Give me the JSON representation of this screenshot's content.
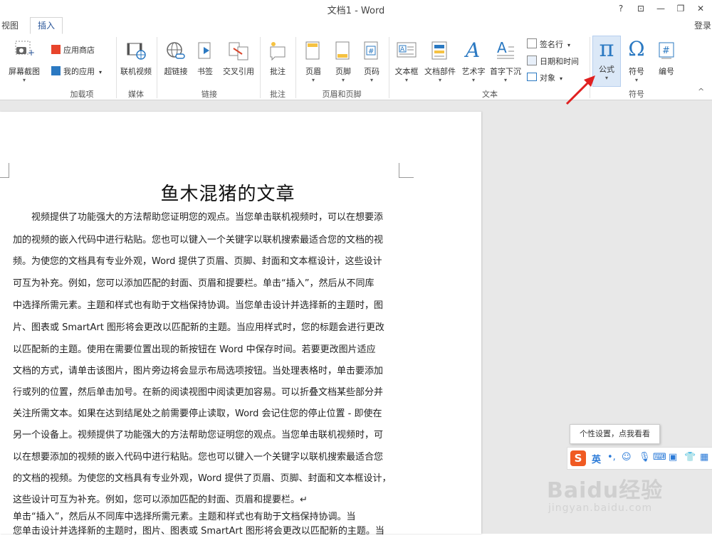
{
  "window": {
    "title": "文档1 - Word",
    "help": "?",
    "controls": [
      "⊡",
      "—",
      "❐",
      "✕"
    ],
    "login": "登录"
  },
  "tabs": {
    "view": "视图",
    "insert": "插入"
  },
  "ribbon": {
    "groups": {
      "addins": "加载项",
      "media": "媒体",
      "links": "链接",
      "comments": "批注",
      "header_footer": "页眉和页脚",
      "text": "文本",
      "symbols": "符号"
    },
    "buttons": {
      "screenshot": "屏幕截图",
      "app_store": "应用商店",
      "my_apps": "我的应用",
      "online_video": "联机视频",
      "hyperlink": "超链接",
      "bookmark": "书签",
      "cross_reference": "交叉引用",
      "comment": "批注",
      "header": "页眉",
      "footer": "页脚",
      "page_number": "页码",
      "text_box": "文本框",
      "quick_parts": "文档部件",
      "wordart": "艺术字",
      "drop_cap": "首字下沉",
      "signature_line": "签名行",
      "date_time": "日期和时间",
      "object": "对象",
      "equation": "公式",
      "symbol": "符号",
      "number": "编号"
    },
    "collapse": "^"
  },
  "document": {
    "heading": "鱼木混猪的文章",
    "lines": [
      "视频提供了功能强大的方法帮助您证明您的观点。当您单击联机视频时，可以在想要添",
      "加的视频的嵌入代码中进行粘贴。您也可以键入一个关键字以联机搜索最适合您的文档的视",
      "频。为使您的文档具有专业外观，Word 提供了页眉、页脚、封面和文本框设计，这些设计",
      "可互为补充。例如，您可以添加匹配的封面、页眉和提要栏。单击“插入”，然后从不同库",
      "中选择所需元素。主题和样式也有助于文档保持协调。当您单击设计并选择新的主题时，图",
      "片、图表或 SmartArt 图形将会更改以匹配新的主题。当应用样式时，您的标题会进行更改",
      "以匹配新的主题。使用在需要位置出现的新按钮在 Word 中保存时间。若要更改图片适应",
      "文档的方式，请单击该图片，图片旁边将会显示布局选项按钮。当处理表格时，单击要添加",
      "行或列的位置，然后单击加号。在新的阅读视图中阅读更加容易。可以折叠文档某些部分并",
      "关注所需文本。如果在达到结尾处之前需要停止读取，Word 会记住您的停止位置 - 即使在",
      "另一个设备上。视频提供了功能强大的方法帮助您证明您的观点。当您单击联机视频时，可",
      "以在想要添加的视频的嵌入代码中进行粘贴。您也可以键入一个关键字以联机搜索最适合您",
      "的文档的视频。为使您的文档具有专业外观，Word 提供了页眉、页脚、封面和文本框设计，",
      "这些设计可互为补充。例如，您可以添加匹配的封面、页眉和提要栏。↵",
      "    单击“插入”，然后从不同库中选择所需元素。主题和样式也有助于文档保持协调。当",
      "您单击设计并选择新的主题时，图片、图表或 SmartArt 图形将会更改以匹配新的主题。当"
    ]
  },
  "ime": {
    "tooltip": "个性设置，点我看看",
    "logo": "S",
    "mode": "英"
  },
  "watermark": {
    "logo": "Baidu经验",
    "url": "jingyan.baidu.com"
  },
  "colors": {
    "accent": "#2b579a",
    "arrow": "#e02020",
    "ime_orange": "#f05a22",
    "ime_blue": "#2a7ad8"
  }
}
